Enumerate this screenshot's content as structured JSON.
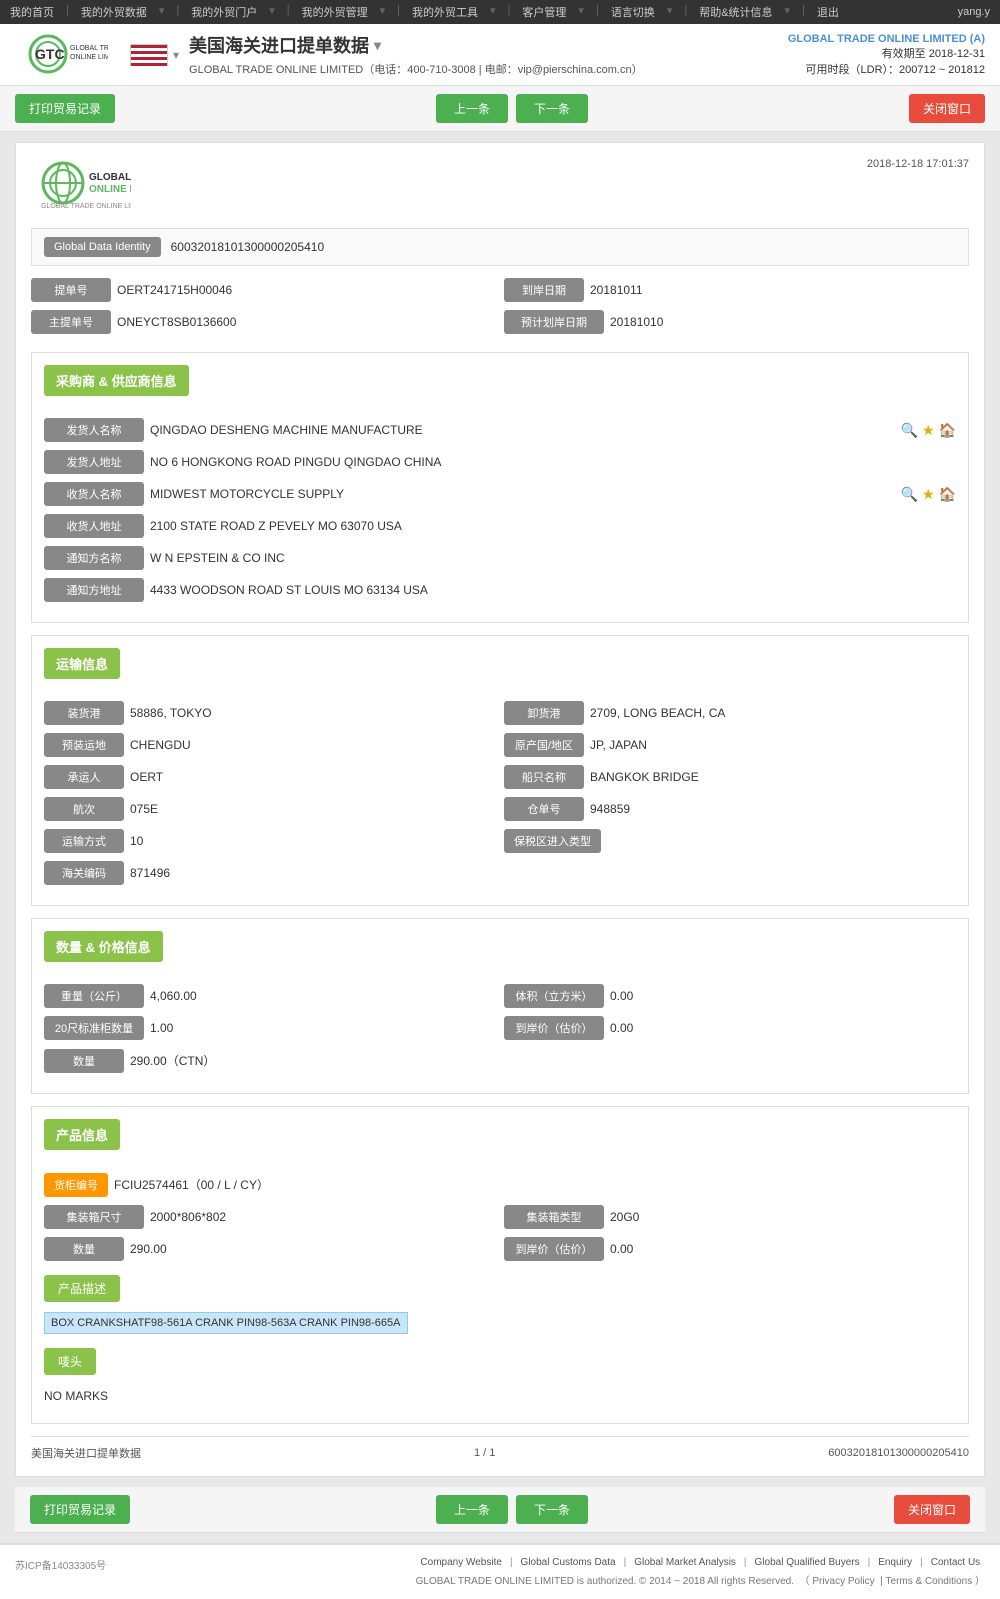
{
  "topnav": {
    "items": [
      "我的首页",
      "我的外贸数据",
      "我的外贸门户",
      "我的外贸管理",
      "我的外贸工具",
      "客户管理",
      "语言切换",
      "帮助&统计信息",
      "退出"
    ],
    "user": "yang.y"
  },
  "header": {
    "company": "GLOBAL TRADE ONLINE LIMITED (A)",
    "valid_until": "有效期至 2018-12-31",
    "ldr": "可用时段（LDR）：200712 ~ 201812",
    "title": "美国海关进口提单数据",
    "subtitle": "GLOBAL TRADE ONLINE LIMITED（电话：400-710-3008 | 电邮：vip@pierschina.com.cn）"
  },
  "toolbar": {
    "print_label": "打印贸易记录",
    "prev_label": "上一条",
    "next_label": "下一条",
    "close_label": "关闭窗口"
  },
  "doc": {
    "datetime": "2018-12-18 17:01:37",
    "global_data_identity_label": "Global Data Identity",
    "global_data_identity_value": "60032018101300000205410",
    "fields": {
      "bill_no_label": "提单号",
      "bill_no_value": "OERT241715H00046",
      "arrival_date_label": "到岸日期",
      "arrival_date_value": "20181011",
      "master_bill_label": "主提单号",
      "master_bill_value": "ONEYCT8SB0136600",
      "est_arrival_label": "预计划岸日期",
      "est_arrival_value": "20181010"
    },
    "supplier": {
      "section_title": "采购商 & 供应商信息",
      "shipper_name_label": "发货人名称",
      "shipper_name_value": "QINGDAO DESHENG MACHINE MANUFACTURE",
      "shipper_addr_label": "发货人地址",
      "shipper_addr_value": "NO 6 HONGKONG ROAD PINGDU QINGDAO CHINA",
      "consignee_name_label": "收货人名称",
      "consignee_name_value": "MIDWEST MOTORCYCLE SUPPLY",
      "consignee_addr_label": "收货人地址",
      "consignee_addr_value": "2100 STATE ROAD Z PEVELY MO 63070 USA",
      "notify_name_label": "通知方名称",
      "notify_name_value": "W N EPSTEIN & CO INC",
      "notify_addr_label": "通知方地址",
      "notify_addr_value": "4433 WOODSON ROAD ST LOUIS MO 63134 USA"
    },
    "transport": {
      "section_title": "运输信息",
      "loading_port_label": "装货港",
      "loading_port_value": "58886, TOKYO",
      "discharge_port_label": "卸货港",
      "discharge_port_value": "2709, LONG BEACH, CA",
      "dest_label": "预装运地",
      "dest_value": "CHENGDU",
      "origin_label": "原产国/地区",
      "origin_value": "JP, JAPAN",
      "carrier_label": "承运人",
      "carrier_value": "OERT",
      "vessel_label": "船只名称",
      "vessel_value": "BANGKOK BRIDGE",
      "voyage_label": "航次",
      "voyage_value": "075E",
      "warehouse_label": "仓单号",
      "warehouse_value": "948859",
      "transport_mode_label": "运输方式",
      "transport_mode_value": "10",
      "bonded_label": "保税区进入类型",
      "bonded_value": "",
      "customs_label": "海关编码",
      "customs_value": "871496"
    },
    "price": {
      "section_title": "数量 & 价格信息",
      "weight_label": "重量（公斤）",
      "weight_value": "4,060.00",
      "volume_label": "体积（立方米）",
      "volume_value": "0.00",
      "container20_label": "20尺标准柜数量",
      "container20_value": "1.00",
      "arrival_price_label": "到岸价（估价）",
      "arrival_price_value": "0.00",
      "quantity_label": "数量",
      "quantity_value": "290.00（CTN）"
    },
    "product": {
      "section_title": "产品信息",
      "container_no_label": "货柜编号",
      "container_no_value": "FCIU2574461（00 / L / CY）",
      "container_size_label": "集装箱尺寸",
      "container_size_value": "2000*806*802",
      "container_type_label": "集装箱类型",
      "container_type_value": "20G0",
      "quantity_label": "数量",
      "quantity_value": "290.00",
      "arrival_price_label": "到岸价（估价）",
      "arrival_price_value": "0.00",
      "desc_label": "产品描述",
      "desc_value": "BOX CRANKSHATF98-561A CRANK PIN98-563A CRANK PIN98-665A",
      "marks_label": "唛头",
      "marks_value": "NO MARKS"
    },
    "footer": {
      "source": "美国海关进口提单数据",
      "page": "1 / 1",
      "record_id": "60032018101300000205410"
    }
  },
  "page_footer": {
    "icp": "苏ICP备14033305号",
    "links": [
      "Company Website",
      "Global Customs Data",
      "Global Market Analysis",
      "Global Qualified Buyers",
      "Enquiry",
      "Contact Us"
    ],
    "copyright": "GLOBAL TRADE ONLINE LIMITED is authorized. © 2014 ~ 2018 All rights Reserved.",
    "privacy": "Privacy Policy",
    "terms": "Terms & Conditions"
  }
}
